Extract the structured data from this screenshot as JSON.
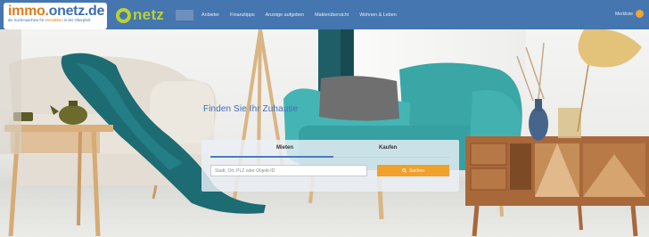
{
  "header": {
    "logo": {
      "brand_prefix": "immo.",
      "brand_suffix": "onetz.de",
      "tagline_a": "die Suchmaschine für ",
      "tagline_b": "Immobilien",
      "tagline_c": " in der Oberpfalz"
    },
    "onetz": {
      "wordmark": "netz",
      "badge": ""
    },
    "nav": [
      {
        "label": "Anbieter"
      },
      {
        "label": "Finanztipps"
      },
      {
        "label": "Anzeige aufgeben"
      },
      {
        "label": "Maklerübersicht"
      },
      {
        "label": "Wohnen & Leben"
      }
    ],
    "account_label": "Merkliste",
    "colors": {
      "bar": "#4576b0",
      "accent": "#e07b1a",
      "onetz_green": "#b9d232"
    }
  },
  "hero": {
    "title": "Finden Sie Ihr Zuhause",
    "search": {
      "tabs": [
        {
          "label": "Mieten",
          "active": true
        },
        {
          "label": "Kaufen",
          "active": false
        }
      ],
      "placeholder": "Stadt, Ort, PLZ oder Objekt-ID",
      "button_label": "Suchen",
      "button_color": "#f0a12b"
    }
  }
}
